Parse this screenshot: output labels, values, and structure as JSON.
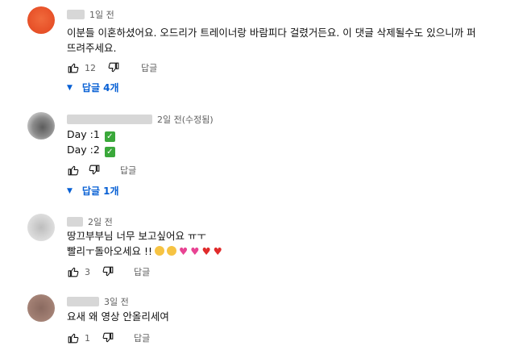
{
  "comments": [
    {
      "timestamp": "1일 전",
      "lines": [
        "이분들 이혼하셨어요. 오드리가 트레이너랑 바람피다 걸렸거든요. 이 댓글 삭제될수도 있으니까 퍼",
        "뜨려주세요."
      ],
      "likes": "12",
      "reply_label": "답글",
      "replies_label": "답글 4개"
    },
    {
      "timestamp": "2일 전(수정됨)",
      "lines": [
        "Day :1",
        "Day :2"
      ],
      "likes": "",
      "reply_label": "답글",
      "replies_label": "답글 1개"
    },
    {
      "timestamp": "2일 전",
      "lines": [
        "땅끄부부님 너무 보고싶어요 ㅠㅜ",
        "빨리ㅜ돌아오세요 !!"
      ],
      "likes": "3",
      "reply_label": "답글"
    },
    {
      "timestamp": "3일 전",
      "lines": [
        "요새 왜 영상 안올리세여"
      ],
      "likes": "1",
      "reply_label": "답글"
    }
  ],
  "icons": {
    "like": "thumbs-up-icon",
    "dislike": "thumbs-down-icon",
    "expand": "triangle-down-icon",
    "check": "check-mark-icon"
  },
  "colors": {
    "link": "#065fd4",
    "meta": "#606060",
    "text": "#0f0f0f"
  }
}
